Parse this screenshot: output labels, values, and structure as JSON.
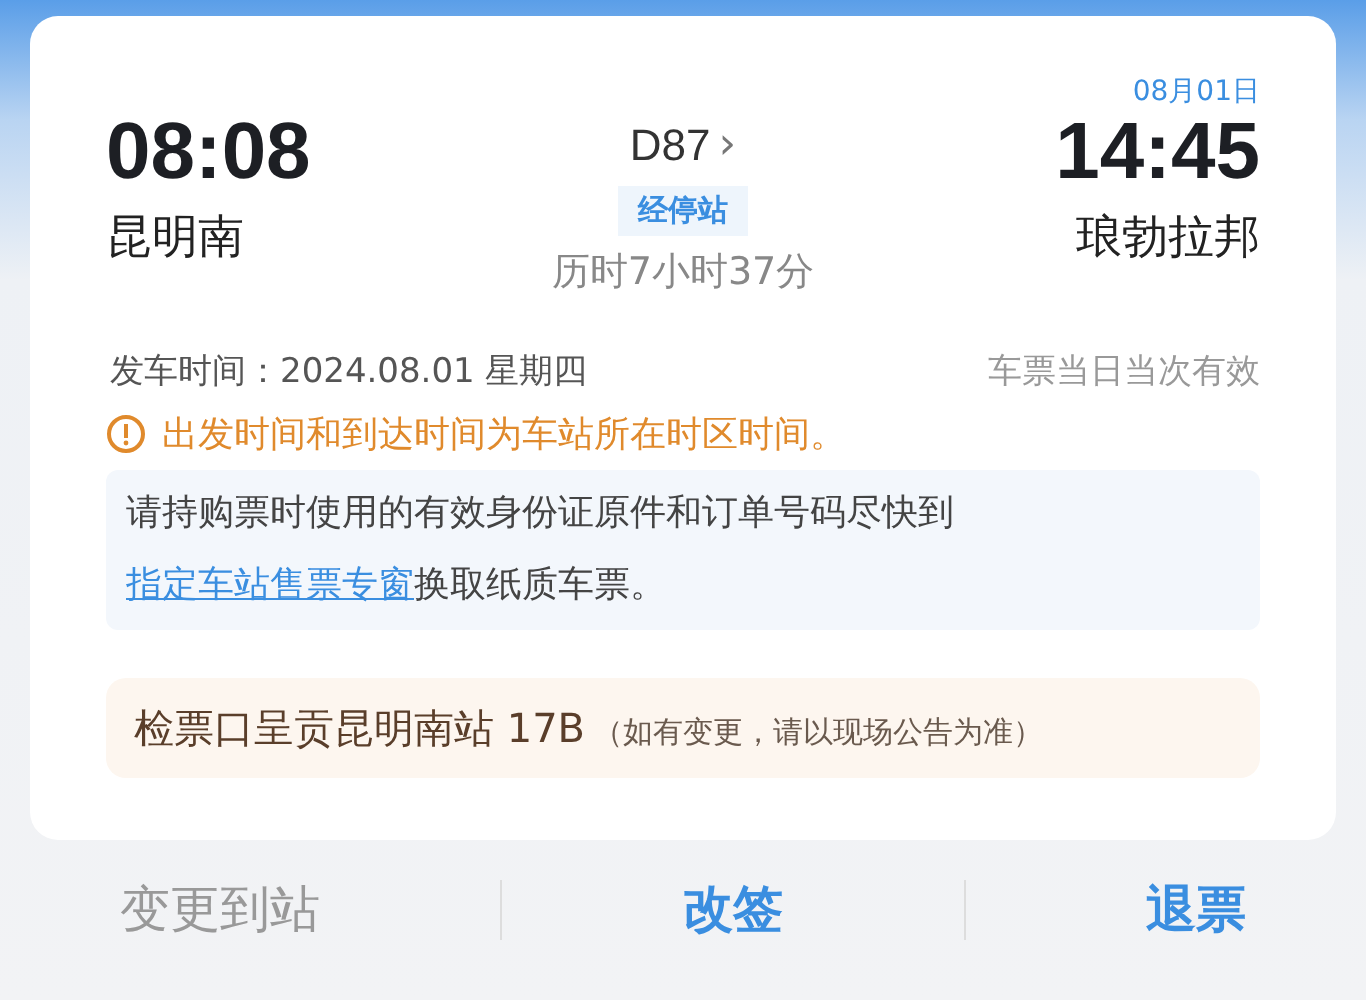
{
  "departure": {
    "time": "08:08",
    "station": "昆明南"
  },
  "train": {
    "number": "D87",
    "chevron": "›",
    "stops_badge": "经停站",
    "duration": "历时7小时37分"
  },
  "arrival": {
    "date": "08月01日",
    "time": "14:45",
    "station": "琅勃拉邦"
  },
  "departure_info": {
    "label": "发车时间：2024.08.01 星期四",
    "validity": "车票当日当次有效"
  },
  "timezone_notice": "出发时间和到达时间为车站所在时区时间。",
  "ticket_tip": {
    "text_before": "请持购票时使用的有效身份证原件和订单号码尽快到",
    "link": "指定车站售票专窗",
    "text_after": "换取纸质车票。"
  },
  "gate": {
    "text": "检票口呈贡昆明南站 17B",
    "note": "（如有变更，请以现场公告为准）"
  },
  "actions": [
    {
      "label": "变更到站",
      "disabled": true
    },
    {
      "label": "改签",
      "disabled": false
    },
    {
      "label": "退票",
      "disabled": false
    }
  ]
}
